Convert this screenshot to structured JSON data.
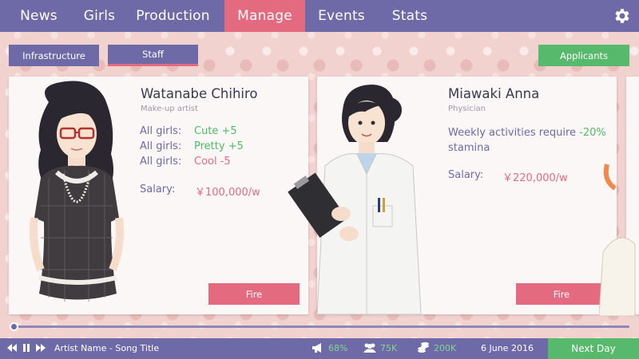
{
  "nav": {
    "tabs": [
      {
        "label": "News",
        "active": false
      },
      {
        "label": "Girls",
        "active": false
      },
      {
        "label": "Production",
        "active": false
      },
      {
        "label": "Manage",
        "active": true
      },
      {
        "label": "Events",
        "active": false
      },
      {
        "label": "Stats",
        "active": false
      }
    ],
    "settings_icon": "gear-icon"
  },
  "subtabs": {
    "infrastructure": "Infrastructure",
    "staff": "Staff",
    "applicants": "Applicants"
  },
  "staff": [
    {
      "name": "Watanabe Chihiro",
      "role": "Make-up artist",
      "traits": [
        {
          "label": "All girls:",
          "value": "Cute +5"
        },
        {
          "label": "All girls:",
          "value": "Pretty +5"
        },
        {
          "label": "All girls:",
          "value": "Cool -5"
        }
      ],
      "salary_label": "Salary:",
      "salary": "￥100,000/w",
      "fire_label": "Fire"
    },
    {
      "name": "Miawaki Anna",
      "role": "Physician",
      "ability_text": "Weekly activities require",
      "ability_value": "-20%",
      "ability_tail": "stamina",
      "salary_label": "Salary:",
      "salary": "￥220,000/w",
      "fire_label": "Fire"
    }
  ],
  "player": {
    "song_title": "Artist Name - Song Title"
  },
  "status": {
    "fans_pct": "68%",
    "fans_count": "75K",
    "money": "200K",
    "date": "6 June 2016"
  },
  "next_day_label": "Next Day",
  "colors": {
    "primary": "#6e6aa7",
    "accent": "#e46b7f",
    "positive": "#57b96b",
    "background": "#f2d2cf"
  }
}
